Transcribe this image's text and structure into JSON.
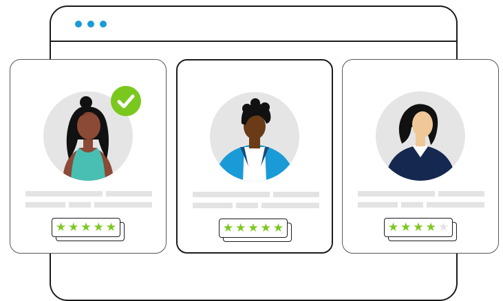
{
  "browser": {
    "dot_color": "#1a9bd7",
    "window_dots": 3
  },
  "colors": {
    "star_on": "#7ac81e",
    "star_off": "#e3e3e3",
    "check_badge": "#7ac81e",
    "placeholder_line": "#e3e3e3",
    "avatar_background": "#e5e5e5"
  },
  "profiles": [
    {
      "person": "woman-teal-top",
      "verified": true,
      "rating": 5,
      "rating_max": 5
    },
    {
      "person": "man-blue-jacket",
      "verified": false,
      "rating": 5,
      "rating_max": 5
    },
    {
      "person": "woman-navy-blouse",
      "verified": false,
      "rating": 4,
      "rating_max": 5
    }
  ],
  "icons": {
    "check": "checkmark-icon",
    "star": "star-icon"
  }
}
